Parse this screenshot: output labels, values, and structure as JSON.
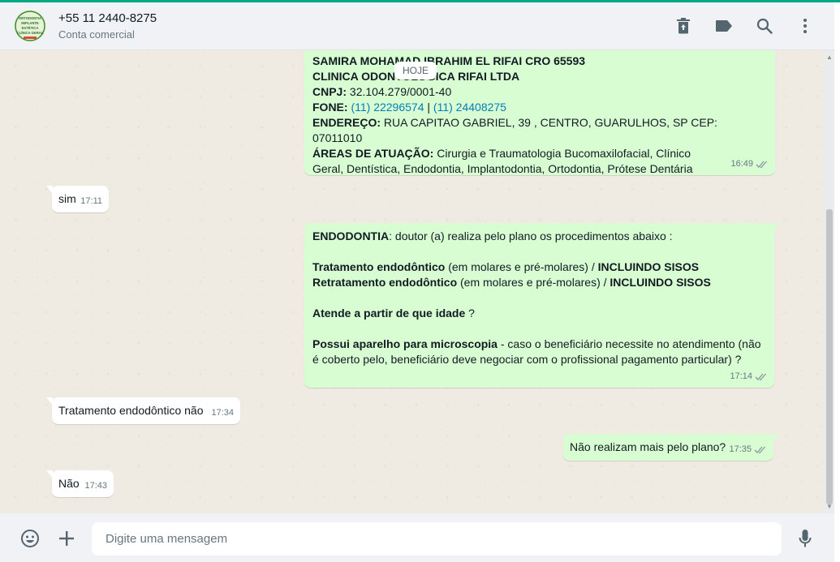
{
  "header": {
    "contact_name": "+55 11 2440-8275",
    "contact_subtitle": "Conta comercial",
    "avatar_text": [
      "ORTODONTIA",
      "IMPLANTE",
      "ESTÉTICA",
      "CLÍNICA GERAL"
    ],
    "icons": [
      "delete-chat-icon",
      "label-icon",
      "search-icon",
      "menu-icon"
    ]
  },
  "chat": {
    "date_label": "HOJE",
    "messages": [
      {
        "direction": "outgoing",
        "time": "16:49",
        "lines": {
          "l1": "SAMIRA MOHAMAD IBRAHIM EL RIFAI CRO 65593",
          "l2": "CLINICA ODONTOLOGICA RIFAI LTDA",
          "cnpj_label": "CNPJ:",
          "cnpj_value": " 32.104.279/0001-40",
          "fone_label": "FONE:",
          "fone_1": "(11) 22296574",
          "fone_sep": " | ",
          "fone_2": "(11) 24408275",
          "endereco_label": "ENDEREÇO:",
          "endereco_value": " RUA CAPITAO GABRIEL, 39 , CENTRO, GUARULHOS, SP CEP: 07011010",
          "areas_label": "ÁREAS DE ATUAÇÃO:",
          "areas_value": " Cirurgia e Traumatologia Bucomaxilofacial, Clínico Geral, Dentística, Endodontia, Implantodontia, Ortodontia, Prótese Dentária"
        }
      },
      {
        "direction": "incoming",
        "time": "17:11",
        "text": "sim"
      },
      {
        "direction": "outgoing",
        "time": "17:14",
        "lines": {
          "endo_label": "ENDODONTIA",
          "endo_text": ":  doutor (a) realiza pelo plano os procedimentos abaixo :",
          "trat_label": "Tratamento endodôntico",
          "trat_mid": " (em molares e pré-molares) / ",
          "trat_end": "INCLUINDO SISOS",
          "retrat_label": "Retratamento endodôntico",
          "retrat_mid": " (em molares e pré-molares) / ",
          "retrat_end": "INCLUINDO SISOS",
          "idade_label": "Atende a partir de que idade",
          "idade_end": "  ?",
          "micro_label": "Possui aparelho para microscopia",
          "micro_text": " - caso o beneficiário necessite no atendimento (não é coberto pelo, beneficiário deve negociar com o profissional pagamento particular)  ?"
        }
      },
      {
        "direction": "incoming",
        "time": "17:34",
        "text": "Tratamento endodôntico não"
      },
      {
        "direction": "outgoing",
        "time": "17:35",
        "text": "Não realizam mais pelo plano?"
      },
      {
        "direction": "incoming",
        "time": "17:43",
        "text": "Não"
      }
    ]
  },
  "footer": {
    "placeholder": "Digite uma mensagem",
    "icons": [
      "emoji-icon",
      "attach-plus-icon",
      "microphone-icon"
    ]
  },
  "colors": {
    "accent": "#00a884",
    "outgoing_bubble": "#d9fdd3",
    "incoming_bubble": "#ffffff",
    "link": "#027eb5",
    "chat_background": "#efeae2"
  }
}
